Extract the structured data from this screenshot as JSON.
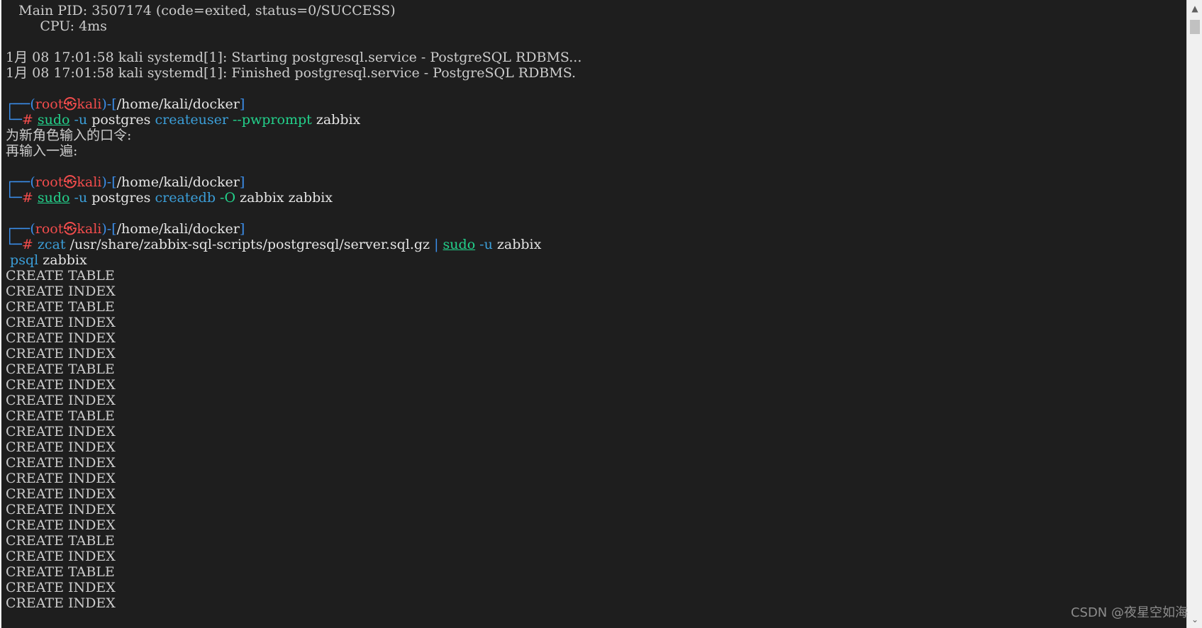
{
  "terminal": {
    "colors": {
      "background": "#1e1e1e",
      "text": "#cccccc",
      "frame": "#3b8eea",
      "root_user": "#f14c4c",
      "command": "#23d18b",
      "argument": "#3b9ed8"
    },
    "status_lines": [
      "   Main PID: 3507174 (code=exited, status=0/SUCCESS)",
      "        CPU: 4ms",
      "",
      "1月 08 17:01:58 kali systemd[1]: Starting postgresql.service - PostgreSQL RDBMS...",
      "1月 08 17:01:58 kali systemd[1]: Finished postgresql.service - PostgreSQL RDBMS."
    ],
    "prompt": {
      "frame_top": "┌──(",
      "user": "root",
      "skull": "㉿",
      "host": "kali",
      "frame_mid": ")-[",
      "path": "/home/kali/docker",
      "frame_end": "]",
      "frame_bottom": "└─",
      "hash": "# "
    },
    "cmd1": {
      "sudo": "sudo",
      "flag_u": " -u",
      "user": " postgres",
      "tool": " createuser",
      "flag": " --pwprompt",
      "arg": " zabbix"
    },
    "pw_prompt_1": "为新角色输入的口令:",
    "pw_prompt_2": "再输入一遍:",
    "cmd2": {
      "sudo": "sudo",
      "flag_u": " -u",
      "user": " postgres",
      "tool": " createdb",
      "flag": " -O",
      "arg": " zabbix zabbix"
    },
    "cmd3": {
      "tool": "zcat",
      "path": " /usr/share/zabbix-sql-scripts/postgresql/server.sql.gz",
      "pipe": " | ",
      "sudo": "sudo",
      "flag_u": " -u",
      "user": " zabbix",
      "cont_tool": " psql",
      "cont_arg": " zabbix"
    },
    "output_lines": [
      "CREATE TABLE",
      "CREATE INDEX",
      "CREATE TABLE",
      "CREATE INDEX",
      "CREATE INDEX",
      "CREATE INDEX",
      "CREATE TABLE",
      "CREATE INDEX",
      "CREATE INDEX",
      "CREATE TABLE",
      "CREATE INDEX",
      "CREATE INDEX",
      "CREATE INDEX",
      "CREATE INDEX",
      "CREATE INDEX",
      "CREATE INDEX",
      "CREATE INDEX",
      "CREATE TABLE",
      "CREATE INDEX",
      "CREATE TABLE",
      "CREATE INDEX",
      "CREATE INDEX"
    ]
  },
  "scrollbar": {
    "up_icon": "▲",
    "down_icon": "⌄"
  },
  "watermark": "CSDN @夜星空如海"
}
